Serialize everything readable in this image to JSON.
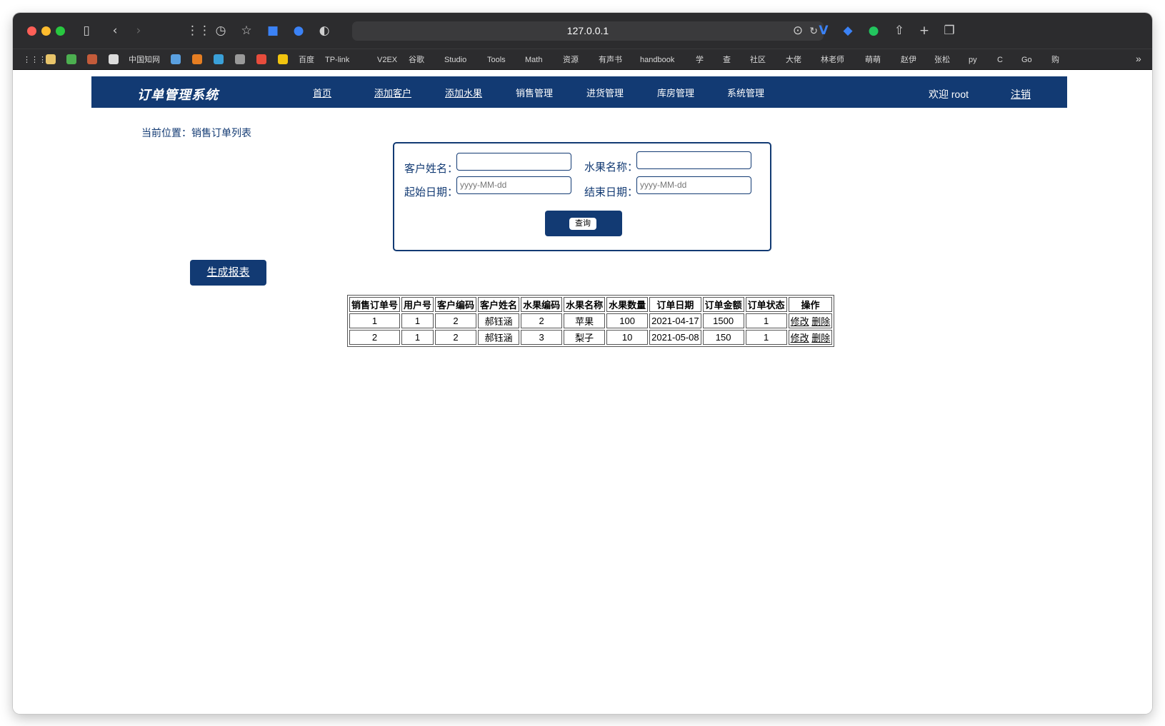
{
  "browser": {
    "url": "127.0.0.1",
    "bookmarks": [
      "中国知网",
      "百度",
      "TP-link",
      "V2EX",
      "谷歌",
      "Studio",
      "Tools",
      "Math",
      "资源",
      "有声书",
      "handbook",
      "学",
      "查",
      "社区",
      "大佬",
      "林老师",
      "萌萌",
      "赵伊",
      "张松",
      "py",
      "C",
      "Go",
      "购"
    ]
  },
  "header": {
    "brand": "订单管理系统",
    "nav": [
      "首页",
      "添加客户",
      "添加水果",
      "销售管理",
      "进货管理",
      "库房管理",
      "系统管理"
    ],
    "welcome": "欢迎 root",
    "logout": "注销"
  },
  "breadcrumb": "当前位置：销售订单列表",
  "search": {
    "customer_label": "客户姓名：",
    "fruit_label": "水果名称：",
    "start_label": "起始日期：",
    "end_label": "结束日期：",
    "customer_value": "",
    "fruit_value": "",
    "start_placeholder": "yyyy-MM-dd",
    "end_placeholder": "yyyy-MM-dd",
    "query_button": "查询"
  },
  "report_button": "生成报表",
  "table": {
    "headers": [
      "销售订单号",
      "用户号",
      "客户编码",
      "客户姓名",
      "水果编码",
      "水果名称",
      "水果数量",
      "订单日期",
      "订单金额",
      "订单状态",
      "操作"
    ],
    "rows": [
      [
        "1",
        "1",
        "2",
        "郝钰涵",
        "2",
        "苹果",
        "100",
        "2021-04-17",
        "1500",
        "1"
      ],
      [
        "2",
        "1",
        "2",
        "郝钰涵",
        "3",
        "梨子",
        "10",
        "2021-05-08",
        "150",
        "1"
      ]
    ],
    "edit_label": "修改",
    "delete_label": "删除"
  }
}
